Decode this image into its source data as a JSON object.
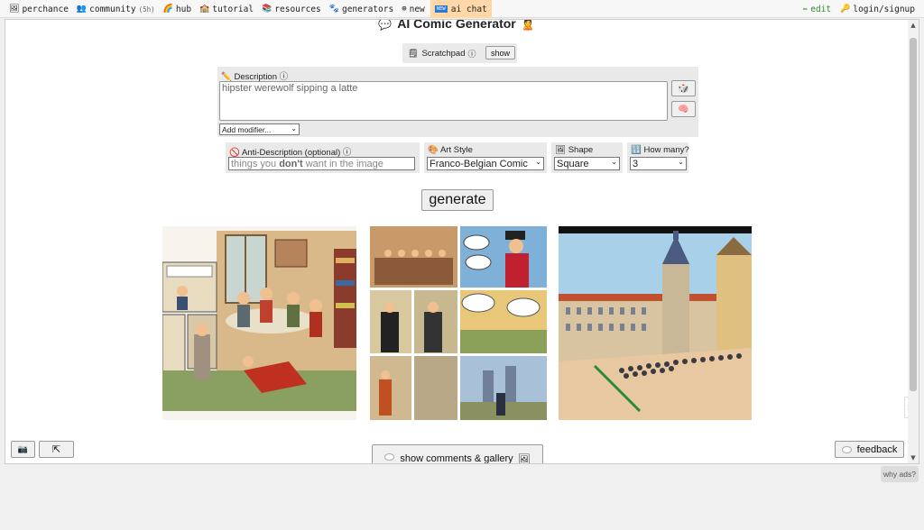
{
  "nav": {
    "items": [
      {
        "label": "perchance",
        "icon": "frame-icon"
      },
      {
        "label": "community",
        "badge": "(5h)",
        "icon": "people-icon"
      },
      {
        "label": "hub",
        "icon": "rainbow-icon"
      },
      {
        "label": "tutorial",
        "icon": "school-icon"
      },
      {
        "label": "resources",
        "icon": "books-icon"
      },
      {
        "label": "generators",
        "icon": "paw-icon"
      },
      {
        "label": "new",
        "icon": "globe-icon"
      },
      {
        "label": "ai chat",
        "icon": "new-badge-icon",
        "new_badge": "NEW"
      }
    ],
    "edit": "edit",
    "login": "login/signup"
  },
  "page": {
    "title": "AI Comic Generator",
    "scratchpad_label": "Scratchpad",
    "show_label": "show",
    "description_label": "Description",
    "description_value": "hipster werewolf sipping a latte",
    "modifier_select": "Add modifier...",
    "anti_label": "Anti-Description (optional)",
    "anti_placeholder_before": "things you ",
    "anti_placeholder_bold": "don't",
    "anti_placeholder_after": " want in the image",
    "art_style_label": "Art Style",
    "art_style_value": "Franco-Belgian Comic",
    "shape_label": "Shape",
    "shape_value": "Square",
    "how_many_label": "How many?",
    "how_many_value": "3",
    "generate_label": "generate",
    "comments_label": "show comments & gallery",
    "feedback_label": "feedback"
  },
  "why_ads": "why ads?",
  "colors": {
    "accent_tab": "#ffd7a8",
    "edit_green": "#2e8b2e",
    "panel_bg": "#e9e9e9"
  }
}
